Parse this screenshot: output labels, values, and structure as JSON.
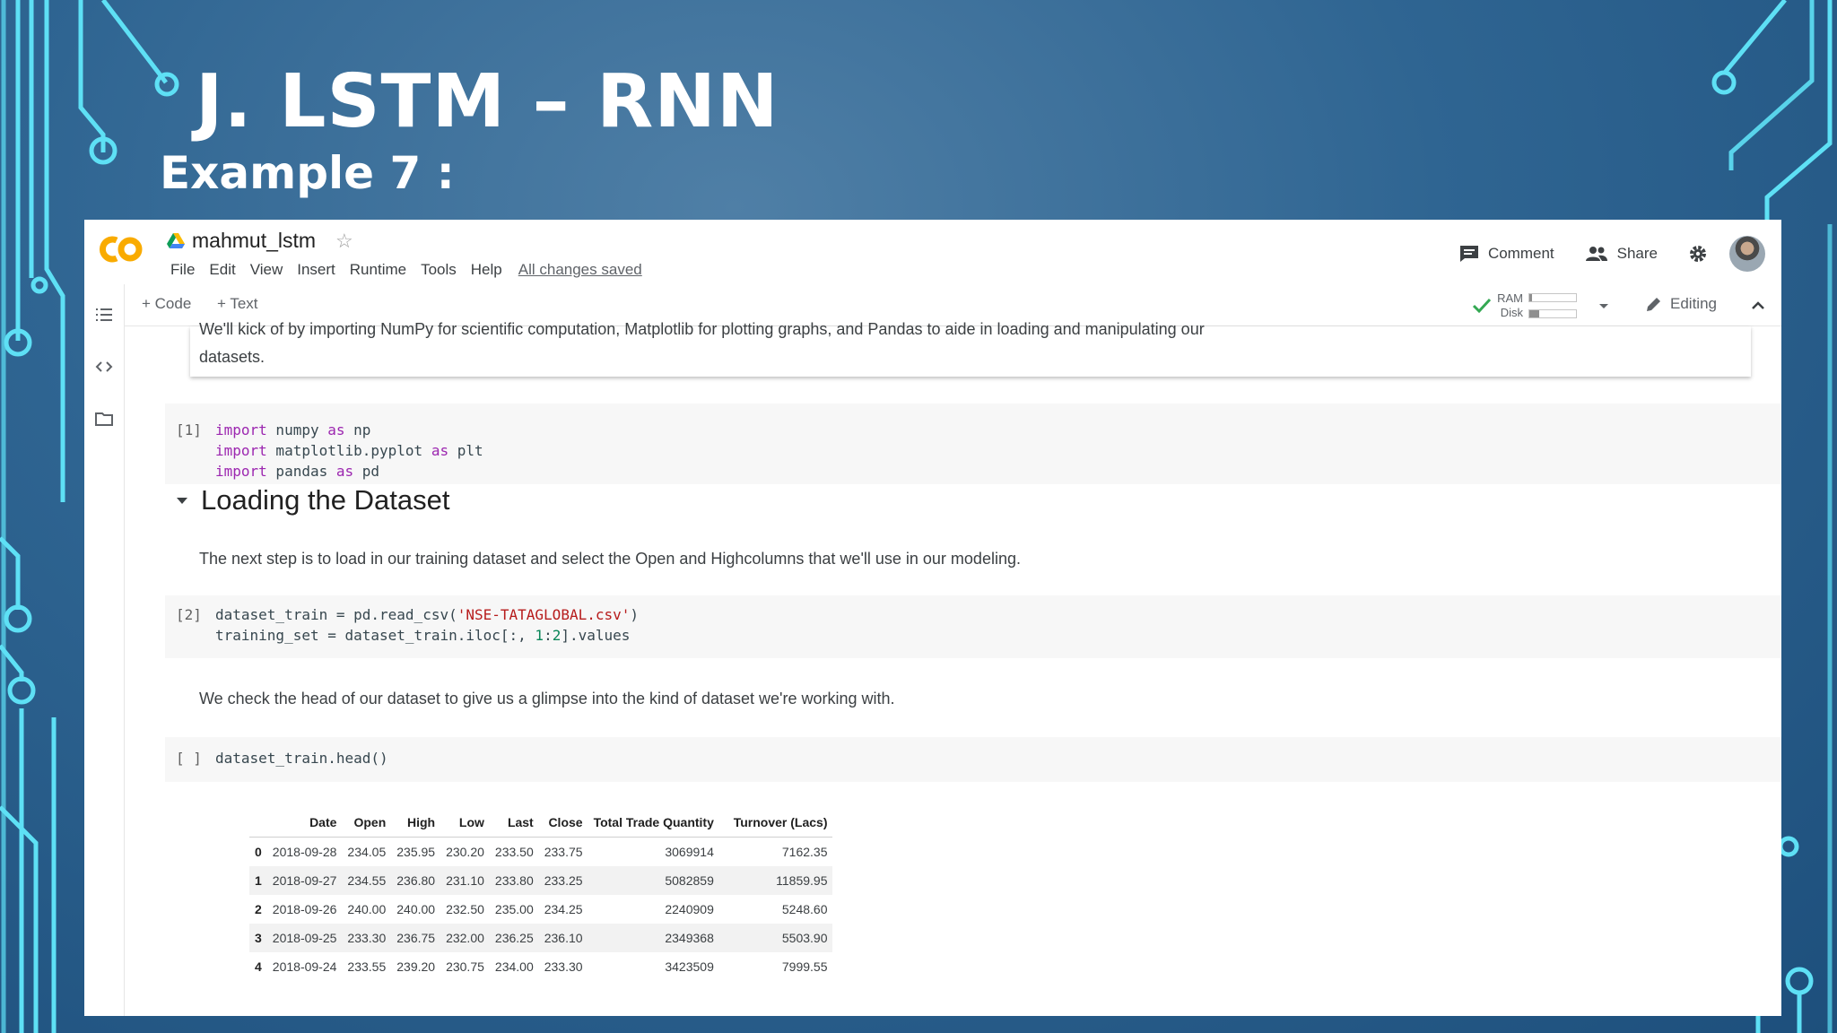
{
  "slide": {
    "title": "J. LSTM – RNN",
    "subtitle": "Example 7 :"
  },
  "header": {
    "notebook_name": "mahmut_lstm",
    "menu": [
      "File",
      "Edit",
      "View",
      "Insert",
      "Runtime",
      "Tools",
      "Help"
    ],
    "saved_status": "All changes saved",
    "comment_label": "Comment",
    "share_label": "Share"
  },
  "toolbar": {
    "add_code": "+ Code",
    "add_text": "+ Text",
    "ram_label": "RAM",
    "disk_label": "Disk",
    "ram_usage": 0.05,
    "disk_usage": 0.22,
    "editing_label": "Editing"
  },
  "cells": {
    "intro_text_1": "We'll kick of by importing NumPy for scientific computation, Matplotlib for plotting graphs, and Pandas to aide in loading and manipulating our",
    "intro_text_2": "datasets.",
    "cell1_prompt": "[1]",
    "cell1_lines": [
      {
        "kw": "import",
        "mid": " numpy ",
        "kw2": "as",
        "end": " np"
      },
      {
        "kw": "import",
        "mid": " matplotlib.pyplot ",
        "kw2": "as",
        "end": " plt"
      },
      {
        "kw": "import",
        "mid": " pandas ",
        "kw2": "as",
        "end": " pd"
      }
    ],
    "section_title": "Loading the Dataset",
    "load_text": "The next step is to load in our training dataset and select the Open and Highcolumns that we'll use in our modeling.",
    "cell2_prompt": "[2]",
    "cell2_line1_a": "dataset_train = pd.read_csv(",
    "cell2_line1_str": "'NSE-TATAGLOBAL.csv'",
    "cell2_line1_b": ")",
    "cell2_line2_a": "training_set = dataset_train.iloc[:, ",
    "cell2_line2_n1": "1",
    "cell2_line2_mid": ":",
    "cell2_line2_n2": "2",
    "cell2_line2_b": "].values",
    "head_text": "We check the head of our dataset to give us a glimpse into the kind of dataset we're working with.",
    "cell3_prompt": "[ ]",
    "cell3_code": "dataset_train.head()"
  },
  "table": {
    "columns": [
      "",
      "Date",
      "Open",
      "High",
      "Low",
      "Last",
      "Close",
      "Total Trade Quantity",
      "Turnover (Lacs)"
    ],
    "rows": [
      [
        "0",
        "2018-09-28",
        "234.05",
        "235.95",
        "230.20",
        "233.50",
        "233.75",
        "3069914",
        "7162.35"
      ],
      [
        "1",
        "2018-09-27",
        "234.55",
        "236.80",
        "231.10",
        "233.80",
        "233.25",
        "5082859",
        "11859.95"
      ],
      [
        "2",
        "2018-09-26",
        "240.00",
        "240.00",
        "232.50",
        "235.00",
        "234.25",
        "2240909",
        "5248.60"
      ],
      [
        "3",
        "2018-09-25",
        "233.30",
        "236.75",
        "232.00",
        "236.25",
        "236.10",
        "2349368",
        "5503.90"
      ],
      [
        "4",
        "2018-09-24",
        "233.55",
        "239.20",
        "230.75",
        "234.00",
        "233.30",
        "3423509",
        "7999.55"
      ]
    ]
  },
  "colors": {
    "background": "#2f6592",
    "circuit": "#5ee0f5",
    "logo_orange": "#f9ab00",
    "keyword": "#9c27b0",
    "string": "#b71c1c",
    "number": "#098658"
  },
  "icons": {
    "logo": "colab-logo",
    "drive": "drive-icon",
    "star": "star-icon",
    "comment": "comment-icon",
    "share": "people-icon",
    "settings": "gear-icon",
    "check": "check-icon",
    "pencil": "pencil-icon",
    "toc": "table-of-contents-icon",
    "code_snippets": "code-icon",
    "files": "folder-icon"
  }
}
